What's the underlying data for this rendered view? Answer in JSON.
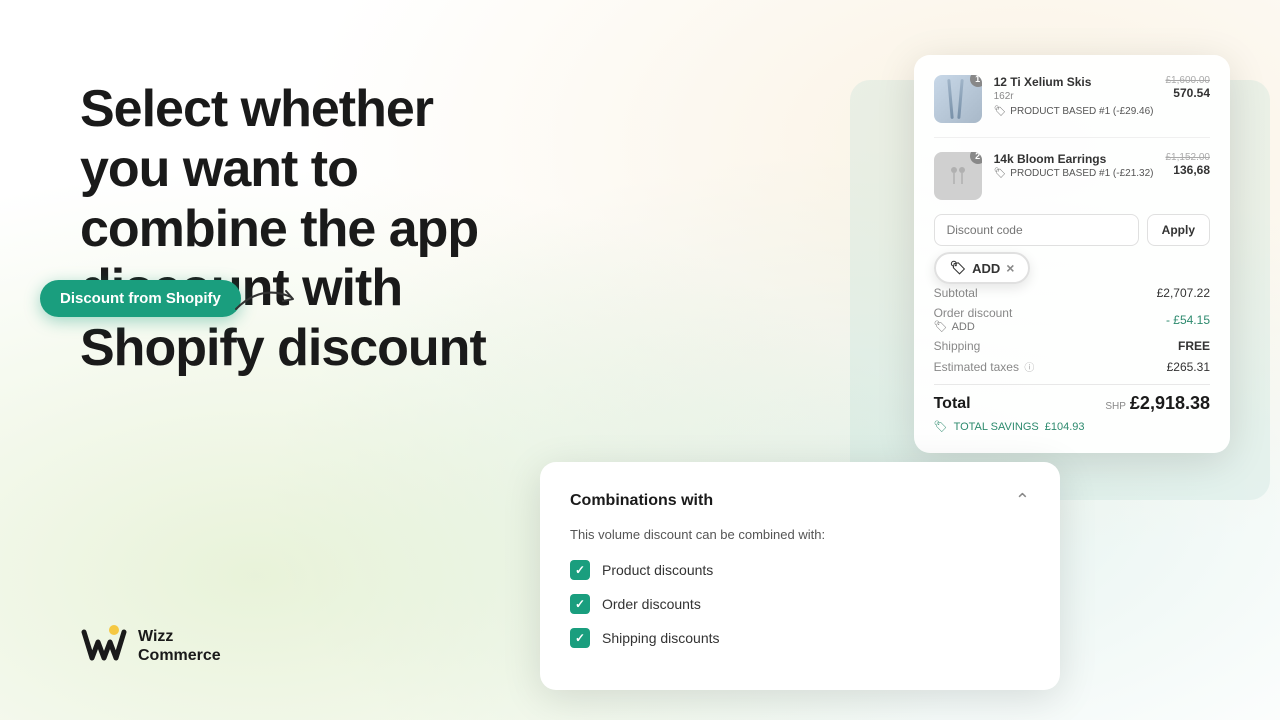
{
  "background": {
    "colors": {
      "accent_green": "#1a9e7e",
      "bg_gradient_yellow": "rgba(245,230,200,0.5)",
      "bg_gradient_green": "rgba(190,225,215,0.4)"
    }
  },
  "heading": {
    "line1": "Select whether",
    "line2": "you want to",
    "line3": "combine the app",
    "line4": "discount with",
    "line5": "Shopify discount"
  },
  "logo": {
    "brand_name_line1": "Wizz",
    "brand_name_line2": "Commerce"
  },
  "order_card": {
    "items": [
      {
        "name": "12 Ti Xelium Skis",
        "variant": "162r",
        "discount_label": "PRODUCT BASED #1 (-£29.46)",
        "price_original": "£1,600.00",
        "price_current": "570.54",
        "badge": "1"
      },
      {
        "name": "14k Bloom Earrings",
        "variant": "",
        "discount_label": "PRODUCT BASED #1 (-£21.32)",
        "price_original": "£1,152.00",
        "price_current": "136,68",
        "badge": "2"
      }
    ],
    "discount_code_placeholder": "Discount code",
    "apply_button": "Apply",
    "add_badge": "ADD",
    "summary": {
      "subtotal_label": "Subtotal",
      "subtotal_value": "£2,707.22",
      "order_discount_label": "Order discount",
      "add_label": "ADD",
      "add_value": "- £54.15",
      "shipping_label": "Shipping",
      "shipping_value": "FREE",
      "taxes_label": "Estimated taxes",
      "taxes_value": "£265.31",
      "total_label": "Total",
      "total_currency_note": "SHP",
      "total_value": "£2,918.38",
      "savings_label": "TOTAL SAVINGS",
      "savings_value": "£104.93"
    }
  },
  "shopify_bubble": {
    "text": "Discount from Shopify"
  },
  "combinations_card": {
    "title": "Combinations with",
    "description": "This volume discount can be combined with:",
    "items": [
      {
        "label": "Product discounts",
        "checked": true
      },
      {
        "label": "Order discounts",
        "checked": true
      },
      {
        "label": "Shipping discounts",
        "checked": true
      }
    ]
  }
}
